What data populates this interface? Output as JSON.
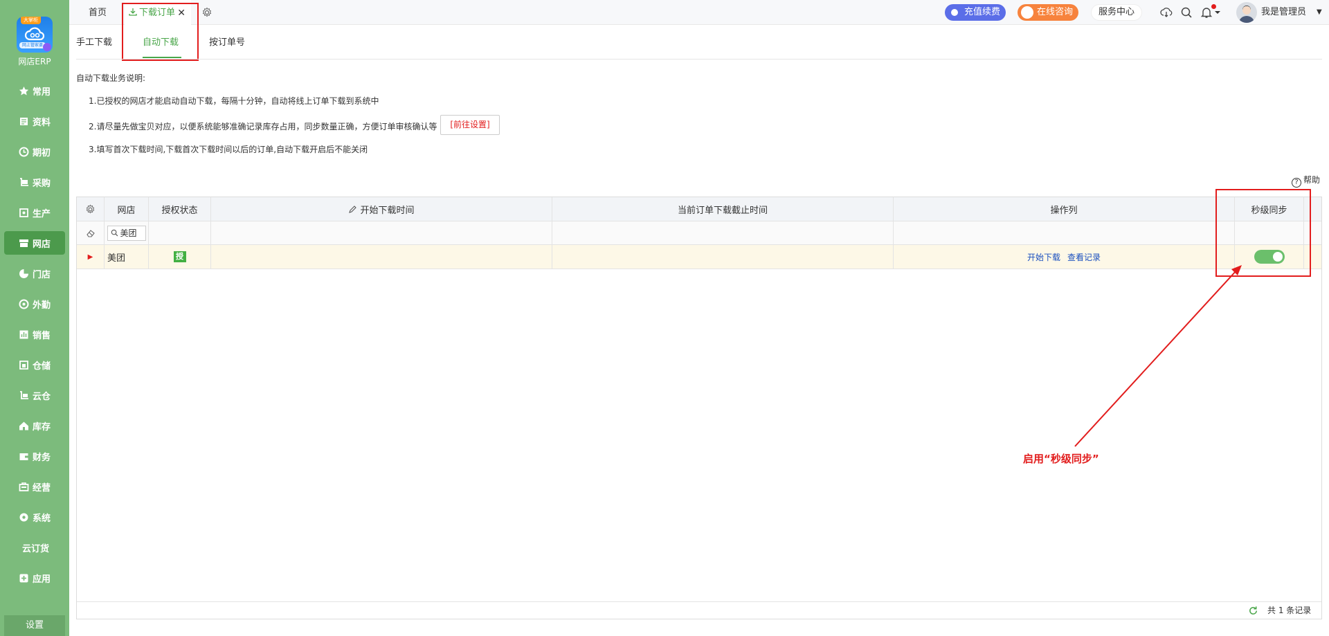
{
  "app": {
    "logo_badge": "大掌柜",
    "logo_sub": "网上管家婆",
    "name": "网店ERP"
  },
  "sidebar": {
    "items": [
      {
        "label": "常用",
        "icon": "star-icon"
      },
      {
        "label": "资料",
        "icon": "document-icon"
      },
      {
        "label": "期初",
        "icon": "clock-icon"
      },
      {
        "label": "采购",
        "icon": "cart-icon"
      },
      {
        "label": "生产",
        "icon": "factory-icon"
      },
      {
        "label": "网店",
        "icon": "store-icon",
        "active": true
      },
      {
        "label": "门店",
        "icon": "pie-chart-icon"
      },
      {
        "label": "外勤",
        "icon": "target-icon"
      },
      {
        "label": "销售",
        "icon": "bar-chart-icon"
      },
      {
        "label": "仓储",
        "icon": "warehouse-icon"
      },
      {
        "label": "云仓",
        "icon": "cloud-warehouse-icon"
      },
      {
        "label": "库存",
        "icon": "home-icon"
      },
      {
        "label": "财务",
        "icon": "wallet-icon"
      },
      {
        "label": "经营",
        "icon": "briefcase-icon"
      },
      {
        "label": "系统",
        "icon": "settings-icon"
      },
      {
        "label": "云订货",
        "icon": ""
      },
      {
        "label": "应用",
        "icon": "plus-square-icon"
      }
    ],
    "settings": "设置"
  },
  "topbar": {
    "home_tab": "首页",
    "active_tab": "下载订单",
    "close_symbol": "✕",
    "recharge": "充值续费",
    "consult": "在线咨询",
    "service": "服务中心",
    "user": "我是管理员"
  },
  "subtabs": {
    "manual": "手工下载",
    "auto": "自动下载",
    "by_order": "按订单号"
  },
  "description": {
    "title": "自动下载业务说明:",
    "line1": "1.已授权的网店才能启动自动下载，每隔十分钟，自动将线上订单下载到系统中",
    "line2": "2.请尽量先做宝贝对应，以便系统能够准确记录库存占用，同步数量正确，方便订单审核确认等",
    "goto_settings": "[前往设置]",
    "line3": "3.填写首次下载时间,下载首次下载时间以后的订单,自动下载开启后不能关闭"
  },
  "help": "帮助",
  "table": {
    "headers": {
      "shop": "网店",
      "auth": "授权状态",
      "start_time": "开始下载时间",
      "cutoff_time": "当前订单下载截止时间",
      "ops": "操作列",
      "sync": "秒级同步"
    },
    "filter": {
      "shop": "美团"
    },
    "rows": [
      {
        "shop": "美团",
        "auth_badge": "授",
        "start_time": "",
        "cutoff_time": "",
        "op_start": "开始下载",
        "op_records": "查看记录",
        "sync_enabled": true
      }
    ],
    "footer": "共 1 条记录"
  },
  "annotation": "启用“秒级同步”",
  "colors": {
    "sidebar": "#7cbb7c",
    "accent": "#4aa64a",
    "highlight": "#e21d1d",
    "link": "#1a4fbf"
  }
}
